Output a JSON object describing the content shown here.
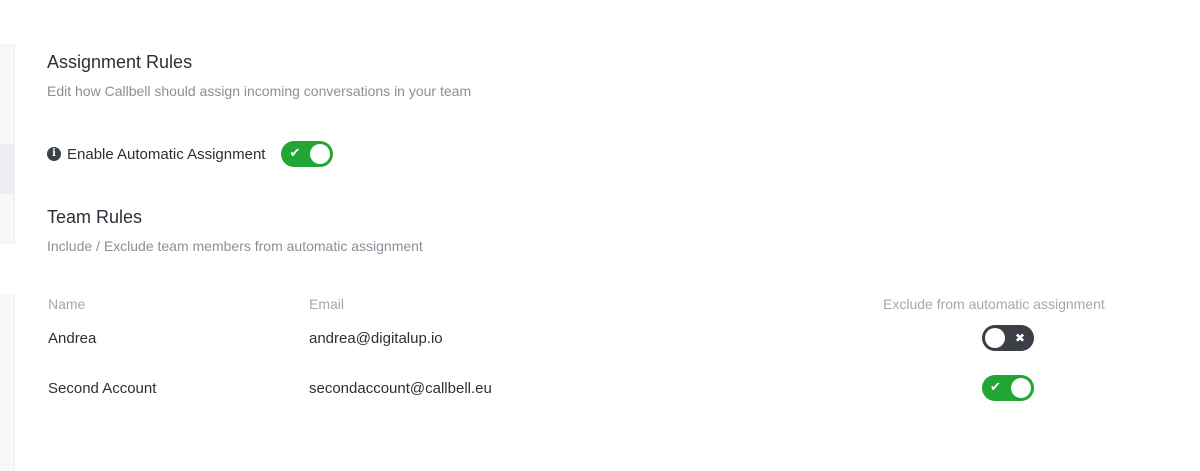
{
  "assignment_rules": {
    "title": "Assignment Rules",
    "description": "Edit how Callbell should assign incoming conversations in your team",
    "enable_label": "Enable Automatic Assignment",
    "info_icon": "info-circle-icon",
    "enabled": true
  },
  "team_rules": {
    "title": "Team Rules",
    "description": "Include / Exclude team members from automatic assignment",
    "columns": {
      "name": "Name",
      "email": "Email",
      "exclude": "Exclude from automatic assignment"
    },
    "members": [
      {
        "name": "Andrea",
        "email": "andrea@digitalup.io",
        "excluded": false
      },
      {
        "name": "Second Account",
        "email": "secondaccount@callbell.eu",
        "excluded": true
      }
    ]
  },
  "colors": {
    "toggle_on": "#22a633",
    "toggle_off": "#3b3e45",
    "title_text": "#2b2f36",
    "muted_text": "#8a8f98"
  }
}
